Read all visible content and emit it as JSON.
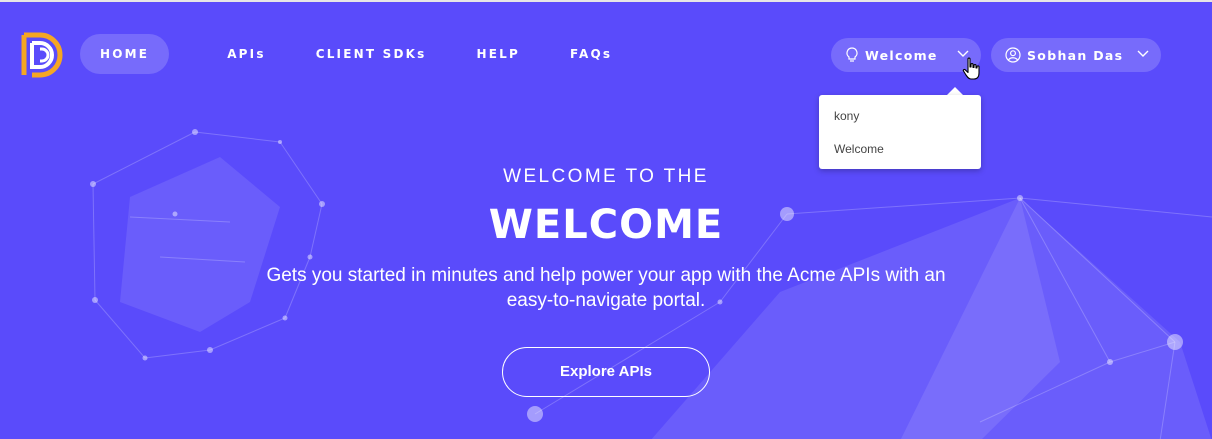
{
  "nav": {
    "items": [
      {
        "label": "HOME"
      },
      {
        "label": "APIs"
      },
      {
        "label": "CLIENT SDKs"
      },
      {
        "label": "HELP"
      },
      {
        "label": "FAQs"
      }
    ]
  },
  "header": {
    "workspace_label": "Welcome",
    "user_name": "Sobhan Das"
  },
  "workspace_dropdown": {
    "options": [
      "kony",
      "Welcome"
    ]
  },
  "hero": {
    "subtitle": "WELCOME TO THE",
    "title": "WELCOME",
    "description": "Gets you started in minutes and help power your app with the Acme APIs with an easy-to-navigate portal.",
    "cta_label": "Explore APIs"
  },
  "colors": {
    "background": "#5a4bfb",
    "logo_orange": "#f5a623",
    "text": "#ffffff"
  },
  "icons": [
    "logo-icon",
    "lightbulb-icon",
    "chevron-down-icon",
    "user-icon",
    "hand-cursor-icon"
  ]
}
